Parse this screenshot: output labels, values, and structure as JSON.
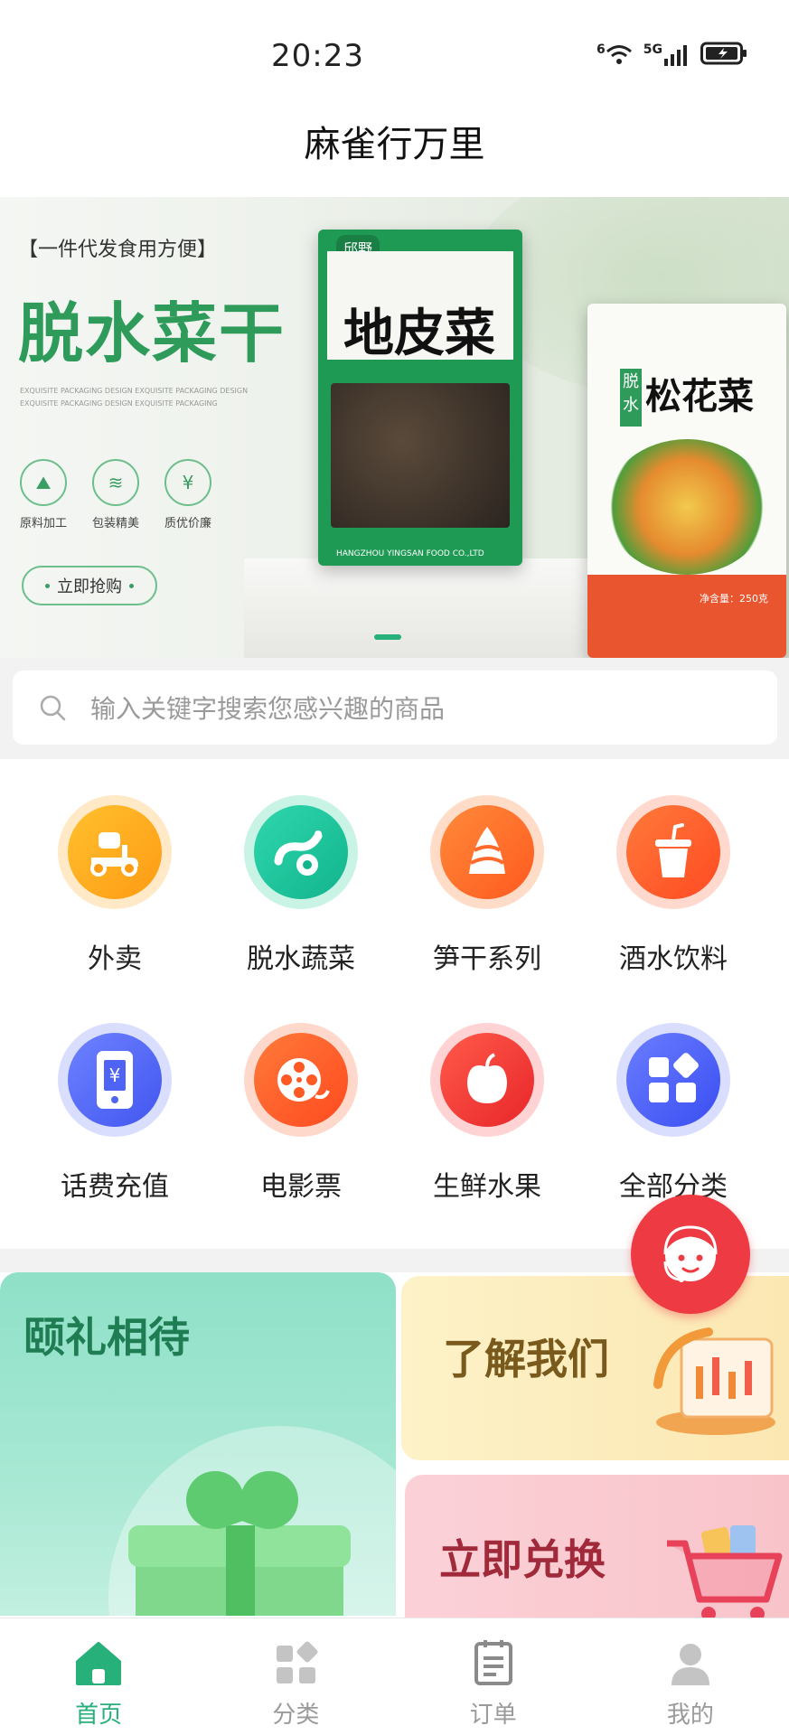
{
  "status_bar": {
    "time": "20:23",
    "net1": "6",
    "net2": "5G"
  },
  "header": {
    "title": "麻雀行万里"
  },
  "banner": {
    "tagline": "【一件代发食用方便】",
    "headline": "脱水菜干",
    "sub_text_1": "EXQUISITE PACKAGING DESIGN EXQUISITE PACKAGING DESIGN",
    "sub_text_2": "EXQUISITE PACKAGING DESIGN EXQUISITE PACKAGING",
    "features": [
      "原料加工",
      "包装精美",
      "质优价廉"
    ],
    "feature_glyphs": [
      "⛰",
      "≋",
      "¥"
    ],
    "cta_label": "立即抢购",
    "product1": {
      "brand": "邱野",
      "name": "地皮菜",
      "footer": "HANGZHOU YINGSAN FOOD CO.,LTD"
    },
    "product2": {
      "tag": "脱水",
      "name": "松花菜",
      "weight": "净含量：250克"
    }
  },
  "search": {
    "placeholder": "输入关键字搜索您感兴趣的商品"
  },
  "categories": [
    {
      "label": "外卖",
      "icon": "scooter-icon"
    },
    {
      "label": "脱水蔬菜",
      "icon": "vegetable-icon"
    },
    {
      "label": "笋干系列",
      "icon": "bamboo-shoot-icon"
    },
    {
      "label": "酒水饮料",
      "icon": "drink-cup-icon"
    },
    {
      "label": "话费充值",
      "icon": "phone-recharge-icon"
    },
    {
      "label": "电影票",
      "icon": "film-reel-icon"
    },
    {
      "label": "生鲜水果",
      "icon": "apple-icon"
    },
    {
      "label": "全部分类",
      "icon": "all-categories-icon"
    }
  ],
  "promos": {
    "left_title": "颐礼相待",
    "right_top_title": "了解我们",
    "right_bottom_title": "立即兑换"
  },
  "tabs": [
    {
      "label": "首页",
      "icon": "home-icon",
      "active": true
    },
    {
      "label": "分类",
      "icon": "category-icon",
      "active": false
    },
    {
      "label": "订单",
      "icon": "order-icon",
      "active": false
    },
    {
      "label": "我的",
      "icon": "profile-icon",
      "active": false
    }
  ],
  "colors": {
    "accent": "#27b07a",
    "service": "#ee3b43"
  }
}
